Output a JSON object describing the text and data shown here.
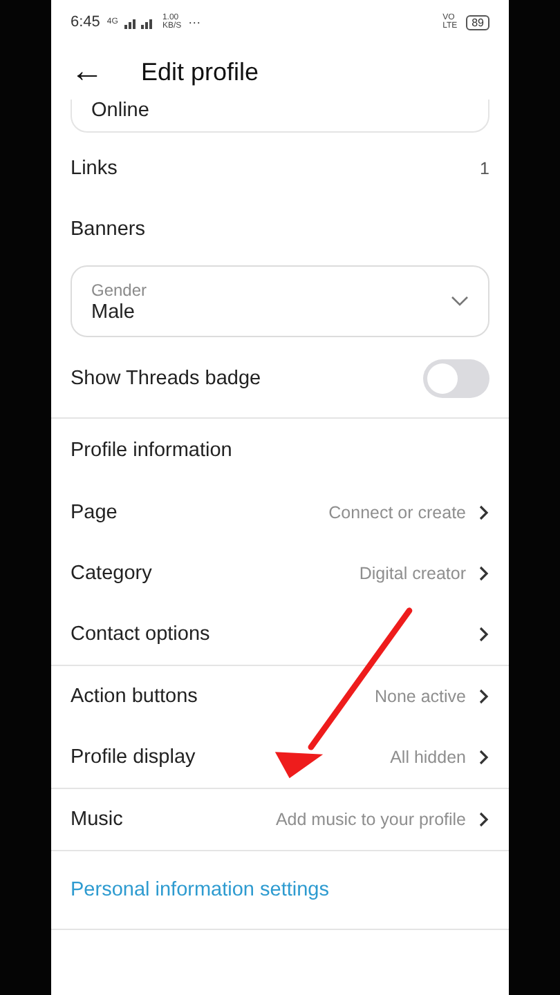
{
  "status_bar": {
    "time": "6:45",
    "network": "4G",
    "speed_value": "1.00",
    "speed_unit": "KB/S",
    "more": "···",
    "volte": "VO LTE",
    "battery": "89"
  },
  "header": {
    "back": "←",
    "title": "Edit profile"
  },
  "sections": [
    {
      "rows": [
        {
          "kind": "partial_field",
          "value": "Online"
        },
        {
          "kind": "count",
          "label": "Links",
          "value": "1"
        },
        {
          "kind": "plain",
          "label": "Banners"
        },
        {
          "kind": "select",
          "label": "Gender",
          "value": "Male"
        },
        {
          "kind": "toggle",
          "label": "Show Threads badge",
          "on": false
        }
      ]
    },
    {
      "rows": [
        {
          "kind": "heading",
          "label": "Profile information"
        },
        {
          "kind": "nav",
          "label": "Page",
          "value": "Connect or create"
        },
        {
          "kind": "nav",
          "label": "Category",
          "value": "Digital creator"
        },
        {
          "kind": "nav",
          "label": "Contact options"
        }
      ]
    },
    {
      "rows": [
        {
          "kind": "nav",
          "label": "Action buttons",
          "value": "None active"
        },
        {
          "kind": "nav",
          "label": "Profile display",
          "value": "All hidden"
        }
      ]
    },
    {
      "rows": [
        {
          "kind": "nav",
          "label": "Music",
          "value": "Add music to your profile"
        }
      ]
    },
    {
      "rows": [
        {
          "kind": "link",
          "label": "Personal information settings"
        }
      ]
    }
  ]
}
